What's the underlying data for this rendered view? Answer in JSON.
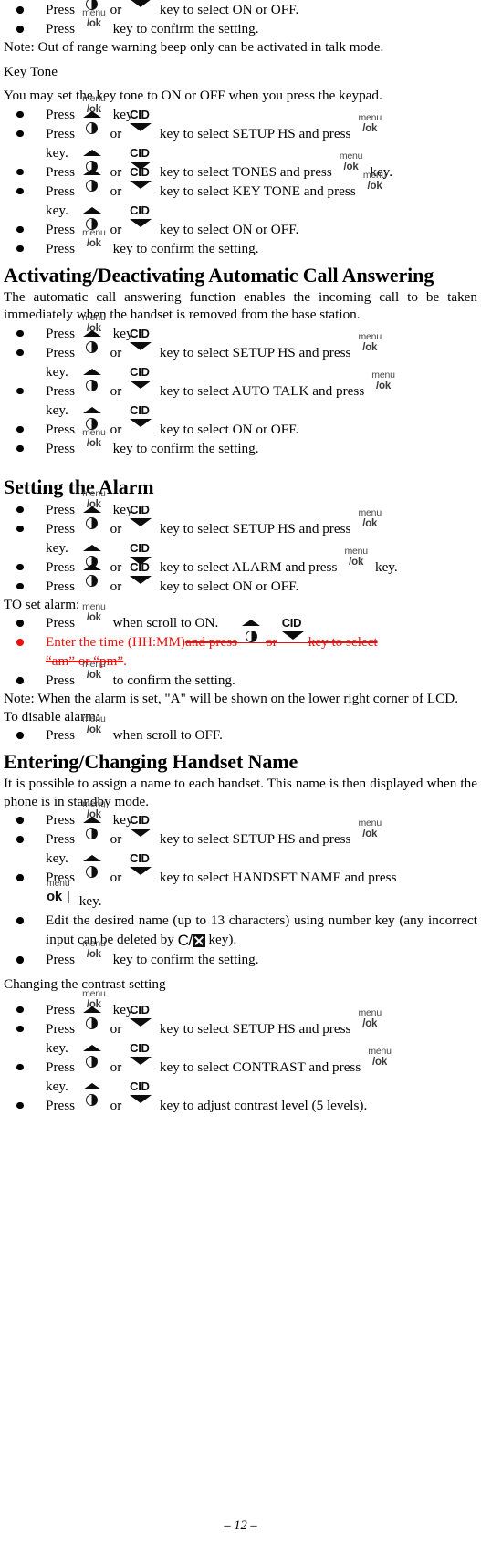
{
  "document": {
    "page_number_label": "– 12 –"
  },
  "icons": {
    "menu_ok": {
      "top": "menu",
      "bottom": "/ok"
    },
    "ok_bold": {
      "top": "menu",
      "bottom": "ok"
    },
    "up_key": "up-triangle-redial",
    "down_key_label": "CID",
    "clear_key_prefix": "C/"
  },
  "blocks": {
    "b1": {
      "press": "Press",
      "or": "or",
      "tail": "key to select ON or OFF."
    },
    "b2": {
      "press": "Press",
      "tail": "key to confirm the setting."
    },
    "note_out_of_range": "Note: Out of range warning beep only can be activated in talk mode."
  },
  "sections": [
    {
      "id": "key-tone",
      "heading": "Key Tone",
      "intro": "You may set the key tone to ON or OFF when you press the keypad."
    },
    {
      "id": "auto-answer",
      "heading": "Activating/Deactivating Automatic Call Answering",
      "intro": "The automatic call answering function enables the incoming call to be taken immediately when the handset is removed from the base station."
    },
    {
      "id": "alarm",
      "heading": "Setting the Alarm"
    },
    {
      "id": "handset-name",
      "heading": "Entering/Changing Handset Name",
      "intro": "It is possible to assign a name to each handset. This name is then displayed when the phone is in standby mode."
    }
  ],
  "steps": {
    "press": "Press",
    "or": "or",
    "key_word": "key.",
    "confirm": "key to confirm the setting.",
    "select_on_off": "key to select ON or OFF.",
    "setup_hs_mid": "key  to  select  SETUP  HS  and  press",
    "setup_hs_mid_plain": "key to select SETUP HS and press",
    "tones_mid": "key to select TONES and press",
    "key_tone_mid": "key  to  select  KEY  TONE  and  press",
    "auto_talk_mid": "key to select AUTO TALK and press",
    "alarm_mid": "key to select ALARM and press",
    "handset_name_mid": "key  to  select  HANDSET NAME  and press",
    "contrast_mid": "key  to  select  CONTRAST  and  press",
    "contrast_adjust": "key to adjust contrast level (5 levels)."
  },
  "alarm": {
    "to_set": "TO set alarm:",
    "press_when_on": "when scroll to ON.",
    "red_plain": "Enter the time (HH:MM)",
    "red_struck_a": "and press",
    "red_struck_or": "or",
    "red_struck_b": "key to select",
    "red_struck_c": "“am” or “pm”",
    "red_period": ".",
    "confirm_setting": "to confirm the setting.",
    "note": "Note: When the alarm is set, \"A\" will be shown on the lower right corner of LCD.",
    "to_disable": "To disable alarm:",
    "press_when_off": "when scroll to OFF."
  },
  "handset_name": {
    "edit_line": "Edit  the  desired  name  (up  to  13  characters)  using  number  key (any incorrect input can be deleted by",
    "edit_tail": "key).",
    "key_word": "key."
  },
  "contrast": {
    "subheading": "Changing the contrast setting"
  }
}
